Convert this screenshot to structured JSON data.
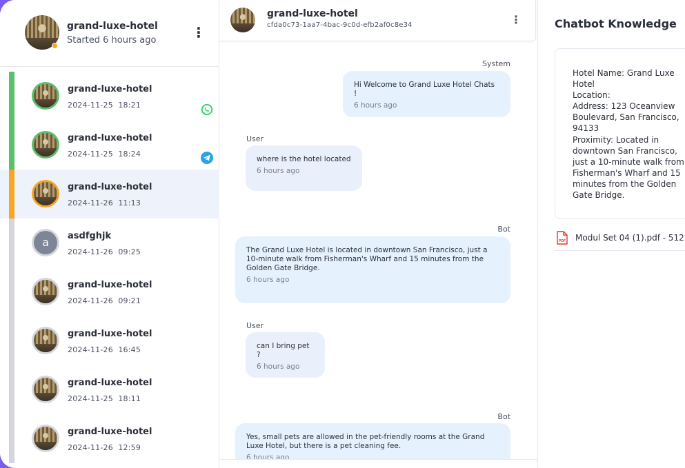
{
  "sidebar": {
    "header": {
      "title": "grand-luxe-hotel",
      "subtitle": "Started 6 hours ago",
      "menu": "⋮"
    },
    "conversations": [
      {
        "name": "grand-luxe-hotel",
        "date": "2024-11-25",
        "time": "18:21",
        "bar_color": "#5cbf6b",
        "ring_color": "#5cbf6b",
        "channel": "whatsapp",
        "avatar": "image"
      },
      {
        "name": "grand-luxe-hotel",
        "date": "2024-11-25",
        "time": "18:24",
        "bar_color": "#5cbf6b",
        "ring_color": "#5cbf6b",
        "channel": "telegram",
        "avatar": "image"
      },
      {
        "name": "grand-luxe-hotel",
        "date": "2024-11-26",
        "time": "11:13",
        "bar_color": "#f5a623",
        "ring_color": "#f5a623",
        "channel": "",
        "avatar": "image",
        "active": true
      },
      {
        "name": "asdfghjk",
        "date": "2024-11-26",
        "time": "09:25",
        "bar_color": "#d4d6db",
        "ring_color": "#d4d6db",
        "channel": "",
        "avatar": "letter",
        "letter": "a"
      },
      {
        "name": "grand-luxe-hotel",
        "date": "2024-11-26",
        "time": "09:21",
        "bar_color": "#d4d6db",
        "ring_color": "#d4d6db",
        "channel": "",
        "avatar": "image"
      },
      {
        "name": "grand-luxe-hotel",
        "date": "2024-11-26",
        "time": "16:45",
        "bar_color": "#d4d6db",
        "ring_color": "#d4d6db",
        "channel": "",
        "avatar": "image"
      },
      {
        "name": "grand-luxe-hotel",
        "date": "2024-11-25",
        "time": "18:11",
        "bar_color": "#d4d6db",
        "ring_color": "#d4d6db",
        "channel": "",
        "avatar": "image"
      },
      {
        "name": "grand-luxe-hotel",
        "date": "2024-11-26",
        "time": "12:59",
        "bar_color": "#d4d6db",
        "ring_color": "#d4d6db",
        "channel": "",
        "avatar": "image"
      }
    ]
  },
  "chat": {
    "header": {
      "title": "grand-luxe-hotel",
      "id": "cfda0c73-1aa7-4bac-9c0d-efb2af0c8e34",
      "menu": "⋮"
    },
    "messages": [
      {
        "sender": "System",
        "text": "Hi Welcome to Grand Luxe Hotel Chats !",
        "time": "6 hours ago"
      },
      {
        "sender": "User",
        "text": "where is the hotel located",
        "time": "6 hours ago"
      },
      {
        "sender": "Bot",
        "text": "The Grand Luxe Hotel is located in downtown San Francisco, just a 10-minute walk from Fisherman's Wharf and 15 minutes from the Golden Gate Bridge.",
        "time": "6 hours ago"
      },
      {
        "sender": "User",
        "text": "can I bring pet ?",
        "time": "6 hours ago"
      },
      {
        "sender": "Bot",
        "text": "Yes, small pets are allowed in the pet-friendly rooms at the Grand Luxe Hotel, but there is a pet cleaning fee.",
        "time": "6 hours ago"
      }
    ]
  },
  "knowledge": {
    "title": "Chatbot Knowledge",
    "text": "Hotel Name: Grand Luxe Hotel\nLocation:\nAddress: 123 Oceanview Boulevard, San Francisco, 94133\nProximity: Located in downtown San Francisco, just a 10-minute walk from Fisherman's Wharf and 15 minutes from the Golden Gate Bridge.",
    "file": "Modul Set 04 (1).pdf - 512"
  },
  "colors": {
    "accent_bg": "#7b5cf0",
    "bubble": "#e5f1fc",
    "active_row": "#eef2fb",
    "whatsapp": "#25d366",
    "telegram": "#2aa3e0",
    "pdf": "#e0352b"
  }
}
